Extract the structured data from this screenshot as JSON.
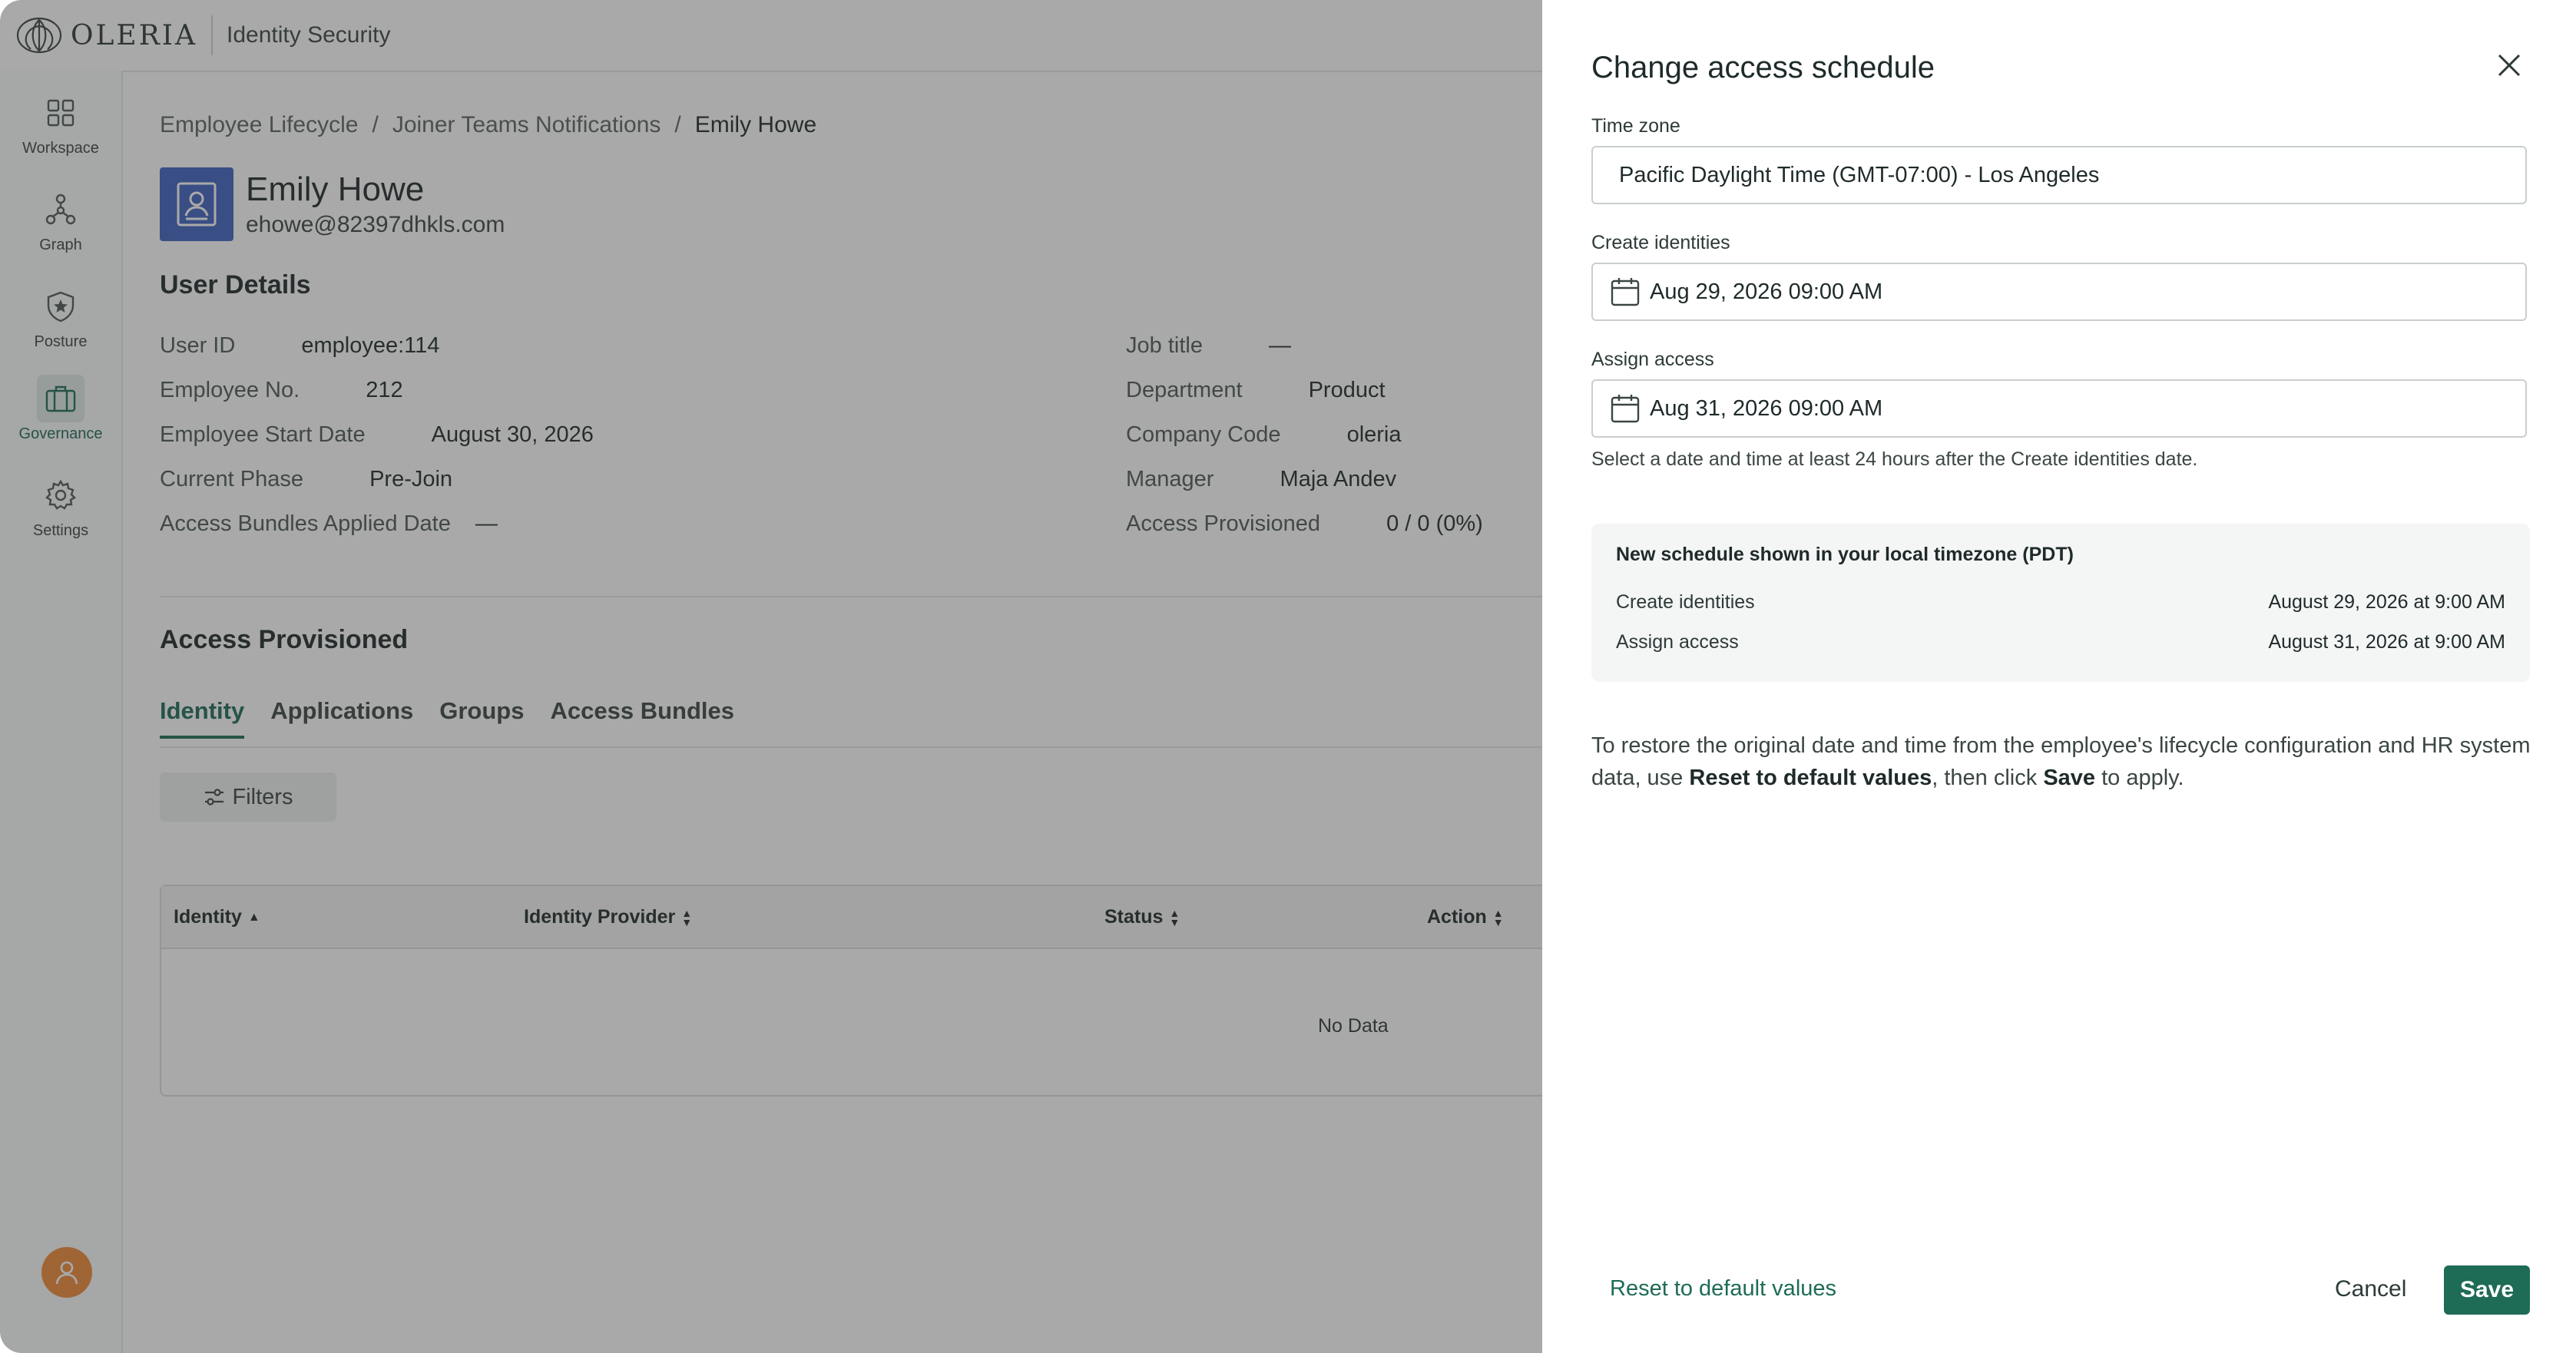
{
  "app": {
    "logo_text": "OLERIA",
    "product": "Identity Security"
  },
  "sidebar": {
    "items": [
      {
        "label": "Workspace",
        "icon": "grid-icon"
      },
      {
        "label": "Graph",
        "icon": "graph-icon"
      },
      {
        "label": "Posture",
        "icon": "shield-star-icon"
      },
      {
        "label": "Governance",
        "icon": "briefcase-icon",
        "active": true
      },
      {
        "label": "Settings",
        "icon": "gear-icon"
      }
    ]
  },
  "breadcrumb": {
    "items": [
      "Employee Lifecycle",
      "Joiner Teams Notifications",
      "Emily Howe"
    ],
    "separator": "/"
  },
  "user": {
    "name": "Emily Howe",
    "email": "ehowe@82397dhkls.com"
  },
  "user_details": {
    "title": "User Details",
    "left": [
      {
        "label": "User ID",
        "value": "employee:114"
      },
      {
        "label": "Employee No.",
        "value": "212"
      },
      {
        "label": "Employee Start Date",
        "value": "August 30, 2026"
      },
      {
        "label": "Current Phase",
        "value": "Pre-Join"
      },
      {
        "label": "Access Bundles Applied Date",
        "value": "—"
      }
    ],
    "right": [
      {
        "label": "Job title",
        "value": "—"
      },
      {
        "label": "Department",
        "value": "Product"
      },
      {
        "label": "Company Code",
        "value": "oleria"
      },
      {
        "label": "Manager",
        "value": "Maja Andev"
      },
      {
        "label": "Access Provisioned",
        "value": "0 / 0 (0%)"
      }
    ]
  },
  "access": {
    "title": "Access Provisioned",
    "tabs": [
      "Identity",
      "Applications",
      "Groups",
      "Access Bundles"
    ],
    "active_tab": "Identity",
    "filters_label": "Filters",
    "columns": [
      "Identity",
      "Identity Provider",
      "Status",
      "Action"
    ],
    "empty_text": "No Data"
  },
  "drawer": {
    "title": "Change access schedule",
    "timezone": {
      "label": "Time zone",
      "value": "Pacific Daylight Time (GMT-07:00) - Los Angeles"
    },
    "create": {
      "label": "Create identities",
      "value": "Aug 29, 2026 09:00 AM"
    },
    "assign": {
      "label": "Assign access",
      "value": "Aug 31, 2026 09:00 AM"
    },
    "hint": "Select a date and time at least 24 hours after the Create identities date.",
    "summary": {
      "heading": "New schedule shown in your local timezone (PDT)",
      "create_label": "Create identities",
      "create_value": "August 29, 2026 at 9:00 AM",
      "assign_label": "Assign access",
      "assign_value": "August 31, 2026 at 9:00 AM"
    },
    "restore": {
      "part1": "To restore the original date and time from the employee's lifecycle configuration and HR system data, use ",
      "bold1": "Reset to default values",
      "part2": ", then click ",
      "bold2": "Save",
      "part3": " to apply."
    },
    "reset_label": "Reset to default values",
    "cancel_label": "Cancel",
    "save_label": "Save"
  },
  "colors": {
    "accent": "#1e6b56",
    "avatar": "#f08a38",
    "user_badge": "#3f63c0"
  }
}
